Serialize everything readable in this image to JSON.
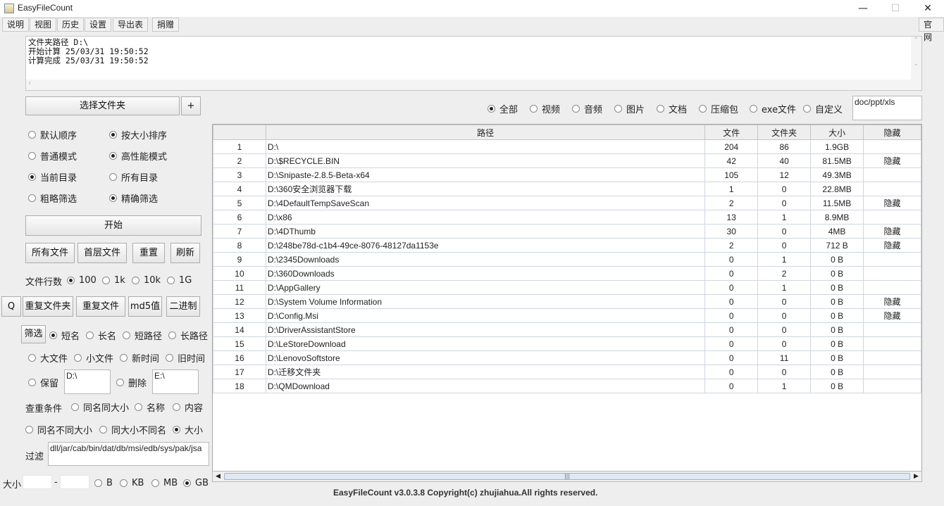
{
  "window": {
    "title": "EasyFileCount",
    "minimize": "—",
    "maximize": "☐",
    "close": "✕"
  },
  "menu": [
    "说明",
    "视图",
    "历史",
    "设置",
    "导出表",
    "捐赠"
  ],
  "menu_right": "官网",
  "log": "文件夹路径 D:\\\n开始计算 25/03/31 19:50:52\n计算完成 25/03/31 19:50:52",
  "left": {
    "select_folder": "选择文件夹",
    "plus": "+",
    "opts": [
      [
        "默认顺序",
        "按大小排序"
      ],
      [
        "普通模式",
        "高性能模式"
      ],
      [
        "当前目录",
        "所有目录"
      ],
      [
        "粗略筛选",
        "精确筛选"
      ]
    ],
    "start": "开始",
    "row_buttons": [
      "所有文件",
      "首层文件",
      "重置",
      "刷新"
    ],
    "file_rows_label": "文件行数",
    "file_rows_opts": [
      "100",
      "1k",
      "10k",
      "1G"
    ],
    "q": "Q",
    "dup_buttons": [
      "重复文件夹",
      "重复文件",
      "md5值",
      "二进制"
    ],
    "filter_btn": "筛选",
    "name_opts": [
      "短名",
      "长名",
      "短路径",
      "长路径"
    ],
    "size_opts": [
      "大文件",
      "小文件",
      "新时间",
      "旧时间"
    ],
    "keep_label": "保留",
    "keep_value": "D:\\",
    "delete_label": "删除",
    "delete_value": "E:\\",
    "dup_cond_label": "查重条件",
    "dup_cond_opts": [
      "同名同大小",
      "名称",
      "内容"
    ],
    "dup_cond_opts2": [
      "同名不同大小",
      "同大小不同名",
      "大小"
    ],
    "filter_label": "过滤",
    "filter_value": "dll/jar/cab/bin/dat/db/msi/edb/sys/pak/jsa",
    "size_label": "大小",
    "size_dash": "-",
    "unit_opts": [
      "B",
      "KB",
      "MB",
      "GB"
    ]
  },
  "types": [
    "全部",
    "视频",
    "音频",
    "图片",
    "文档",
    "压缩包",
    "exe文件",
    "自定义"
  ],
  "custom_ext": "doc/ppt/xls",
  "table": {
    "headers": [
      "",
      "路径",
      "文件",
      "文件夹",
      "大小",
      "隐藏"
    ],
    "rows": [
      [
        "1",
        "D:\\",
        "204",
        "86",
        "1.9GB",
        ""
      ],
      [
        "2",
        "D:\\$RECYCLE.BIN",
        "42",
        "40",
        "81.5MB",
        "隐藏"
      ],
      [
        "3",
        "D:\\Snipaste-2.8.5-Beta-x64",
        "105",
        "12",
        "49.3MB",
        ""
      ],
      [
        "4",
        "D:\\360安全浏览器下载",
        "1",
        "0",
        "22.8MB",
        ""
      ],
      [
        "5",
        "D:\\4DefaultTempSaveScan",
        "2",
        "0",
        "11.5MB",
        "隐藏"
      ],
      [
        "6",
        "D:\\x86",
        "13",
        "1",
        "8.9MB",
        ""
      ],
      [
        "7",
        "D:\\4DThumb",
        "30",
        "0",
        "4MB",
        "隐藏"
      ],
      [
        "8",
        "D:\\248be78d-c1b4-49ce-8076-48127da1153e",
        "2",
        "0",
        "712 B",
        "隐藏"
      ],
      [
        "9",
        "D:\\2345Downloads",
        "0",
        "1",
        "0 B",
        ""
      ],
      [
        "10",
        "D:\\360Downloads",
        "0",
        "2",
        "0 B",
        ""
      ],
      [
        "11",
        "D:\\AppGallery",
        "0",
        "1",
        "0 B",
        ""
      ],
      [
        "12",
        "D:\\System Volume Information",
        "0",
        "0",
        "0 B",
        "隐藏"
      ],
      [
        "13",
        "D:\\Config.Msi",
        "0",
        "0",
        "0 B",
        "隐藏"
      ],
      [
        "14",
        "D:\\DriverAssistantStore",
        "0",
        "0",
        "0 B",
        ""
      ],
      [
        "15",
        "D:\\LeStoreDownload",
        "0",
        "0",
        "0 B",
        ""
      ],
      [
        "16",
        "D:\\LenovoSoftstore",
        "0",
        "11",
        "0 B",
        ""
      ],
      [
        "17",
        "D:\\迁移文件夹",
        "0",
        "0",
        "0 B",
        ""
      ],
      [
        "18",
        "D:\\QMDownload",
        "0",
        "1",
        "0 B",
        ""
      ]
    ]
  },
  "footer": "EasyFileCount v3.0.3.8 Copyright(c) zhujiahua.All rights reserved."
}
